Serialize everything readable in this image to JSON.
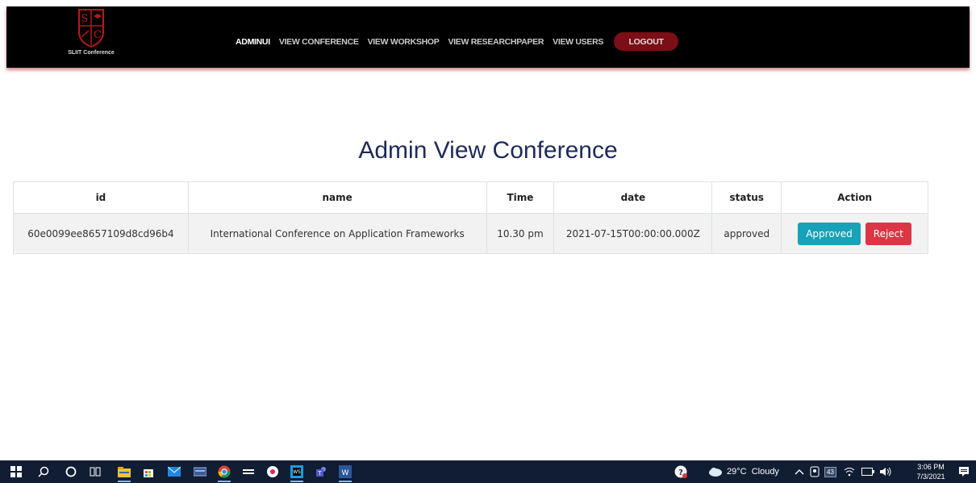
{
  "brand": {
    "logo_text": "SLIIT Conference"
  },
  "nav": {
    "items": [
      "ADMINUI",
      "VIEW CONFERENCE",
      "VIEW WORKSHOP",
      "VIEW RESEARCHPAPER",
      "VIEW USERS"
    ],
    "logout_label": "LOGOUT"
  },
  "page": {
    "title": "Admin View Conference"
  },
  "table": {
    "headers": [
      "id",
      "name",
      "Time",
      "date",
      "status",
      "Action"
    ],
    "rows": [
      {
        "id": "60e0099ee8657109d8cd96b4",
        "name": "International Conference on Application Frameworks",
        "time": "10.30 pm",
        "date": "2021-07-15T00:00:00.000Z",
        "status": "approved",
        "approve_label": "Approved",
        "reject_label": "Reject"
      }
    ]
  },
  "taskbar": {
    "weather": "29°C  Cloudy",
    "badge": "43",
    "time": "3:06 PM",
    "date": "7/3/2021"
  },
  "colors": {
    "navbar": "#000000",
    "logout": "#7b0e16",
    "approve": "#17a2b8",
    "reject": "#dc3545",
    "title": "#1e2a5a",
    "taskbar": "#101d33"
  }
}
